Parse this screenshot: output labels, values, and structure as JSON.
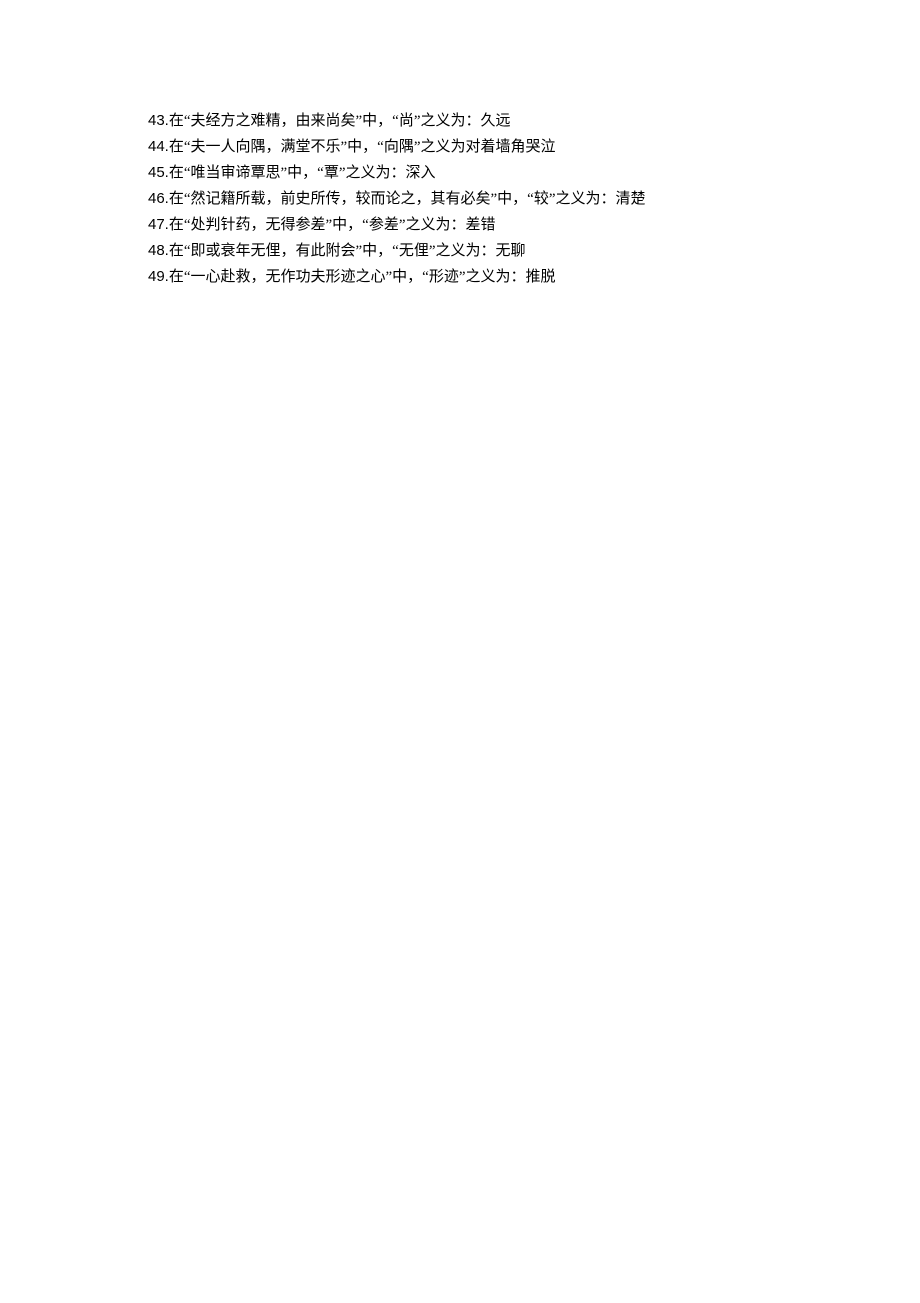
{
  "items": [
    {
      "num": "43.",
      "text": "在“夫经方之难精，由来尚矣”中，“尚”之义为：久远"
    },
    {
      "num": "44.",
      "text": "在“夫一人向隅，满堂不乐”中，“向隅”之义为对着墙角哭泣"
    },
    {
      "num": "45.",
      "text": "在“唯当审谛覃思”中，“覃”之义为：深入"
    },
    {
      "num": "46.",
      "text": "在“然记籍所载，前史所传，较而论之，其有必矣”中，“较”之义为：清楚"
    },
    {
      "num": "47.",
      "text": "在“处判针药，无得参差”中，“参差”之义为：差错"
    },
    {
      "num": "48.",
      "text": "在“即或衰年无俚，有此附会”中，“无俚”之义为：无聊"
    },
    {
      "num": "49.",
      "text": "在“一心赴救，无作功夫形迹之心”中，“形迹”之义为：推脱"
    }
  ]
}
